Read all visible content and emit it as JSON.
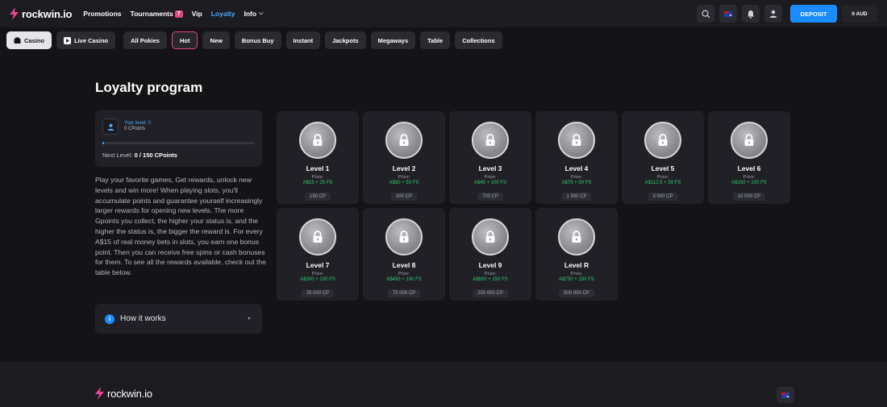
{
  "header": {
    "logo_text": "rockwin.io",
    "nav": [
      {
        "label": "Promotions"
      },
      {
        "label": "Tournaments",
        "badge": "7"
      },
      {
        "label": "Vip"
      },
      {
        "label": "Loyalty",
        "active": true
      },
      {
        "label": "Info"
      }
    ],
    "deposit_label": "DEPOSIT",
    "balance": "0 AUD"
  },
  "categories": [
    "Casino",
    "Live Casino",
    "All Pokies",
    "Hot",
    "New",
    "Bonus Buy",
    "Instant",
    "Jackpots",
    "Megaways",
    "Table",
    "Collections"
  ],
  "main": {
    "title": "Loyalty program",
    "your_level": "Your level: 0",
    "cpoints": "0 CPoints",
    "progress_percent": 1,
    "next_level_label": "Next Level:",
    "next_level_value": "0 / 150 CPoints",
    "description": "Play your favorite games, Get rewards, unlock new levels and win more! When playing slots, you'll accumulate points and guarantee yourself increasingly larger rewards for opening new levels. The more Gpoints you collect, the higher your status is, and the higher the status is, the bigger the reward is. For every A$15 of real money bets in slots, you earn one bonus point. Then you can receive free spins or cash bonuses for them. To see all the rewards available, check out the table below.",
    "how_it_works": "How it works"
  },
  "levels": [
    {
      "name": "Level 1",
      "prize_label": "Prize:",
      "reward": "A$15 + 25 FS",
      "cp": "150 CP"
    },
    {
      "name": "Level 2",
      "prize_label": "Prize:",
      "reward": "A$30 + 50 FS",
      "cp": "300 CP"
    },
    {
      "name": "Level 3",
      "prize_label": "Prize:",
      "reward": "A$45 + 100 FS",
      "cp": "700 CP"
    },
    {
      "name": "Level 4",
      "prize_label": "Prize:",
      "reward": "A$75 + 50 FS",
      "cp": "1 500 CP"
    },
    {
      "name": "Level 5",
      "prize_label": "Prize:",
      "reward": "A$112.5 + 50 FS",
      "cp": "3 000 CP"
    },
    {
      "name": "Level 6",
      "prize_label": "Prize:",
      "reward": "A$150 + 100 FS",
      "cp": "10 000 CP"
    },
    {
      "name": "Level 7",
      "prize_label": "Prize:",
      "reward": "A$300 + 100 FS",
      "cp": "25 000 CP"
    },
    {
      "name": "Level 8",
      "prize_label": "Prize:",
      "reward": "A$450 + 100 FS",
      "cp": "75 000 CP"
    },
    {
      "name": "Level 9",
      "prize_label": "Prize:",
      "reward": "A$600 + 150 FS",
      "cp": "250 000 CP"
    },
    {
      "name": "Level R",
      "prize_label": "Prize:",
      "reward": "A$750 + 150 FS",
      "cp": "500 000 CP"
    }
  ],
  "footer": {
    "logo_text": "rockwin.io"
  },
  "colors": {
    "accent": "#1a8cff",
    "reward": "#2ecc71",
    "hot_border": "#e8457c",
    "background": "#141417"
  }
}
